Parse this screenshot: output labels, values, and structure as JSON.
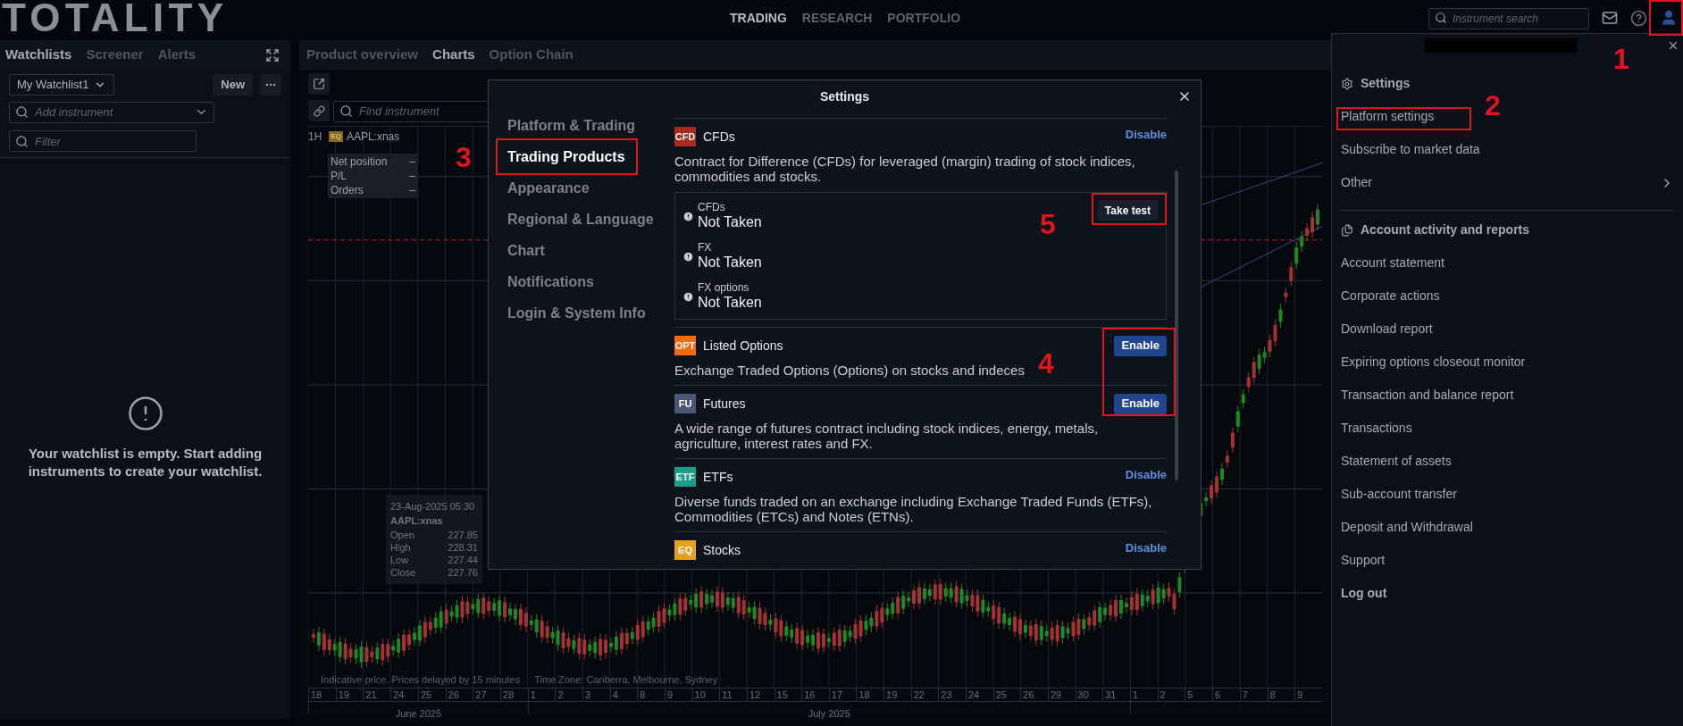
{
  "header": {
    "logo": "TOTALITY",
    "nav": [
      {
        "label": "TRADING",
        "selected": true
      },
      {
        "label": "RESEARCH",
        "selected": false
      },
      {
        "label": "PORTFOLIO",
        "selected": false
      }
    ],
    "search": {
      "placeholder": "Instrument search"
    }
  },
  "watchlist_panel": {
    "tabs": [
      {
        "label": "Watchlists",
        "selected": true
      },
      {
        "label": "Screener",
        "selected": false
      },
      {
        "label": "Alerts",
        "selected": false
      }
    ],
    "list_select": "My Watchlist1",
    "new_button": "New",
    "add_field": {
      "placeholder": "Add instrument"
    },
    "filter_field": {
      "placeholder": "Filter"
    },
    "empty_message": "Your watchlist is empty. Start adding instruments to create your watchlist."
  },
  "chart_panel": {
    "tabs": [
      {
        "label": "Product overview",
        "selected": false
      },
      {
        "label": "Charts",
        "selected": true
      },
      {
        "label": "Option Chain",
        "selected": false
      }
    ],
    "find_field": {
      "placeholder": "Find instrument"
    },
    "interval": "1H",
    "badge": "EQ",
    "symbol": "AAPL:xnas",
    "position": [
      {
        "label": "Net position",
        "value": "–"
      },
      {
        "label": "P/L",
        "value": "–"
      },
      {
        "label": "Orders",
        "value": "–"
      }
    ],
    "tooltip": {
      "time": "23-Aug-2025 05:30",
      "symbol": "AAPL:xnas",
      "rows": [
        {
          "label": "Open",
          "value": "227.85"
        },
        {
          "label": "High",
          "value": "228.31"
        },
        {
          "label": "Low",
          "value": "227.44"
        },
        {
          "label": "Close",
          "value": "227.76"
        }
      ]
    },
    "footnote": "Indicative price. Prices delayed by 15 minutes",
    "timezone": "Time Zone: Canberra, Melbourne, Sydney",
    "x_axis": [
      {
        "label": "June 2025",
        "days": [
          "18",
          "19",
          "21",
          "24",
          "25",
          "26",
          "27",
          "28"
        ]
      },
      {
        "label": "July 2025",
        "days": [
          "1",
          "2",
          "3",
          "4",
          "8",
          "9",
          "10",
          "11",
          "12",
          "15",
          "16",
          "17",
          "18",
          "19",
          "22",
          "23",
          "24",
          "25",
          "26",
          "29",
          "30",
          "31"
        ]
      },
      {
        "days": [
          "1",
          "2",
          "5",
          "6",
          "7",
          "8",
          "9"
        ]
      }
    ]
  },
  "settings_modal": {
    "title": "Settings",
    "nav": [
      {
        "label": "Platform & Trading",
        "selected": false
      },
      {
        "label": "Trading Products",
        "selected": true
      },
      {
        "label": "Appearance",
        "selected": false
      },
      {
        "label": "Regional & Language",
        "selected": false
      },
      {
        "label": "Chart",
        "selected": false
      },
      {
        "label": "Notifications",
        "selected": false
      },
      {
        "label": "Login & System Info",
        "selected": false
      }
    ],
    "products": [
      {
        "code": "CFD",
        "color": "#a8291e",
        "name": "CFDs",
        "enabled": true,
        "action": "Disable",
        "description": "Contract for Difference (CFDs) for leveraged (margin) trading of stock indices, commodities and stocks.",
        "tests": [
          {
            "name": "CFDs",
            "status": "Not Taken"
          },
          {
            "name": "FX",
            "status": "Not Taken"
          },
          {
            "name": "FX options",
            "status": "Not Taken"
          }
        ],
        "test_button": "Take test"
      },
      {
        "code": "OPT",
        "color": "#f46a0e",
        "name": "Listed Options",
        "enabled": false,
        "action": "Enable",
        "description": "Exchange Traded Options (Options) on stocks and indeces"
      },
      {
        "code": "FU",
        "color": "#4b5674",
        "name": "Futures",
        "enabled": false,
        "action": "Enable",
        "description": "A wide range of futures contract including stock indices, energy, metals, agriculture, interest rates and FX."
      },
      {
        "code": "ETF",
        "color": "#1b9e8a",
        "name": "ETFs",
        "enabled": true,
        "action": "Disable",
        "description": "Diverse funds traded on an exchange including Exchange Traded Funds (ETFs), Commodities (ETCs) and Notes (ETNs)."
      },
      {
        "code": "EQ",
        "color": "#e9a11c",
        "name": "Stocks",
        "enabled": true,
        "action": "Disable"
      }
    ]
  },
  "account_menu": {
    "sections": [
      {
        "kind": "settings",
        "title": "Settings",
        "items": [
          {
            "label": "Platform settings",
            "submenu": false
          },
          {
            "label": "Subscribe to market data",
            "submenu": false
          },
          {
            "label": "Other",
            "submenu": true
          }
        ]
      },
      {
        "kind": "reports",
        "title": "Account activity and reports",
        "items": [
          {
            "label": "Account statement",
            "submenu": false
          },
          {
            "label": "Corporate actions",
            "submenu": false
          },
          {
            "label": "Download report",
            "submenu": false
          },
          {
            "label": "Expiring options closeout monitor",
            "submenu": false
          },
          {
            "label": "Transaction and balance report",
            "submenu": false
          },
          {
            "label": "Transactions",
            "submenu": false
          },
          {
            "label": "Statement of assets",
            "submenu": false
          },
          {
            "label": "Sub-account transfer",
            "submenu": false
          },
          {
            "label": "Deposit and Withdrawal",
            "submenu": false
          },
          {
            "label": "Support",
            "submenu": false
          }
        ]
      }
    ],
    "logout": "Log out"
  },
  "annotations": [
    {
      "label": "1"
    },
    {
      "label": "2"
    },
    {
      "label": "3"
    },
    {
      "label": "4"
    },
    {
      "label": "5"
    }
  ]
}
